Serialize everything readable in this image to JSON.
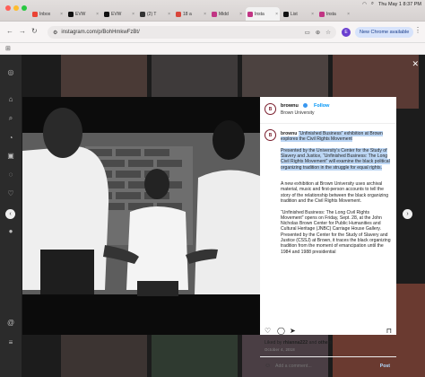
{
  "browser": {
    "tabs": [
      {
        "label": "Inbox",
        "color": "#ea4335",
        "active": false
      },
      {
        "label": "EVW",
        "color": "#111111",
        "active": false
      },
      {
        "label": "EVW",
        "color": "#111111",
        "active": false
      },
      {
        "label": "(2) T",
        "color": "#333333",
        "active": false
      },
      {
        "label": "18 a",
        "color": "#d9463b",
        "active": false
      },
      {
        "label": "Midd",
        "color": "#c13584",
        "active": false
      },
      {
        "label": "Insta",
        "color": "#c13584",
        "active": true
      },
      {
        "label": "List",
        "color": "#111111",
        "active": false
      },
      {
        "label": "Insta",
        "color": "#c13584",
        "active": false
      }
    ],
    "system_time": "Thu May 1  8:37 PM",
    "url": "instagram.com/p/BohHmkwFzBt/",
    "new_chrome_label": "New Chrome available",
    "profile_initial": "E"
  },
  "post": {
    "username": "brownu",
    "follow_label": "Follow",
    "location": "Brown University",
    "avatar_text": "B",
    "caption_user": "brownu",
    "caption_paragraphs": [
      "“Unfinished Business” exhibition at Brown explores the Civil Rights Movement",
      "Presented by the University’s Center for the Study of Slavery and Justice, “Unfinished Business: The Long Civil Rights Movement” will examine the black political organizing tradition in the struggle for equal rights.",
      "A new exhibition at Brown University uses archival material, music and first-person accounts to tell the story of the relationship between the black organizing tradition and the Civil Rights Movement.",
      "“Unfinished Business: The Long Civil Rights Movement” opens on Friday, Sept. 28, at the John Nicholas Brown Center for Public Humanities and Cultural Heritage (JNBC) Carriage House Gallery. Presented by the Center for the Study of Slavery and Justice (CSSJ) at Brown, it traces the black organizing tradition from the moment of emancipation until the 1984 and 1988 presidential"
    ],
    "liked_by_prefix": "Liked by ",
    "liked_by_user": "rhianna222",
    "liked_by_suffix": " and ",
    "liked_by_others": "others",
    "date": "October 4, 2018",
    "comment_placeholder": "Add a comment...",
    "post_label": "Post"
  }
}
